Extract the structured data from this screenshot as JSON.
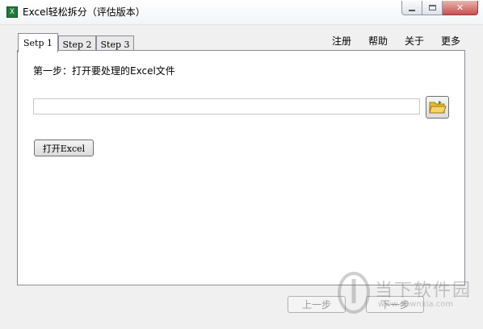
{
  "window": {
    "title": "Excel轻松拆分（评估版本）",
    "icon_letter": "X"
  },
  "tabs": [
    {
      "label": "Setp 1",
      "active": true
    },
    {
      "label": "Step 2",
      "active": false
    },
    {
      "label": "Step 3",
      "active": false
    }
  ],
  "menu": {
    "register": "注册",
    "help": "帮助",
    "about": "关于",
    "more": "更多"
  },
  "step1": {
    "instruction": "第一步：打开要处理的Excel文件",
    "path_value": "",
    "open_button": "打开Excel"
  },
  "nav": {
    "prev": "上一步",
    "next": "下一步"
  },
  "watermark": {
    "brand": "当下软件园",
    "url": "www.downxia.com"
  },
  "colors": {
    "close_button": "#c75050",
    "app_icon": "#1f7a3a"
  }
}
